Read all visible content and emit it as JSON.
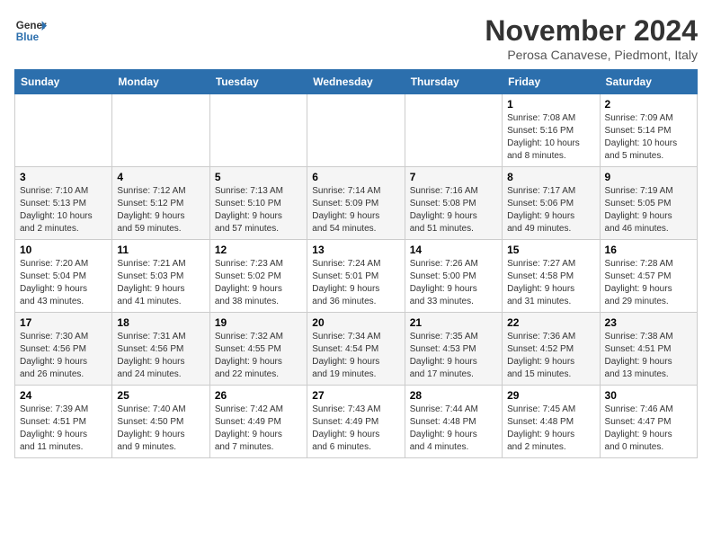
{
  "header": {
    "logo_line1": "General",
    "logo_line2": "Blue",
    "month_title": "November 2024",
    "location": "Perosa Canavese, Piedmont, Italy"
  },
  "weekdays": [
    "Sunday",
    "Monday",
    "Tuesday",
    "Wednesday",
    "Thursday",
    "Friday",
    "Saturday"
  ],
  "weeks": [
    [
      {
        "day": "",
        "info": ""
      },
      {
        "day": "",
        "info": ""
      },
      {
        "day": "",
        "info": ""
      },
      {
        "day": "",
        "info": ""
      },
      {
        "day": "",
        "info": ""
      },
      {
        "day": "1",
        "info": "Sunrise: 7:08 AM\nSunset: 5:16 PM\nDaylight: 10 hours\nand 8 minutes."
      },
      {
        "day": "2",
        "info": "Sunrise: 7:09 AM\nSunset: 5:14 PM\nDaylight: 10 hours\nand 5 minutes."
      }
    ],
    [
      {
        "day": "3",
        "info": "Sunrise: 7:10 AM\nSunset: 5:13 PM\nDaylight: 10 hours\nand 2 minutes."
      },
      {
        "day": "4",
        "info": "Sunrise: 7:12 AM\nSunset: 5:12 PM\nDaylight: 9 hours\nand 59 minutes."
      },
      {
        "day": "5",
        "info": "Sunrise: 7:13 AM\nSunset: 5:10 PM\nDaylight: 9 hours\nand 57 minutes."
      },
      {
        "day": "6",
        "info": "Sunrise: 7:14 AM\nSunset: 5:09 PM\nDaylight: 9 hours\nand 54 minutes."
      },
      {
        "day": "7",
        "info": "Sunrise: 7:16 AM\nSunset: 5:08 PM\nDaylight: 9 hours\nand 51 minutes."
      },
      {
        "day": "8",
        "info": "Sunrise: 7:17 AM\nSunset: 5:06 PM\nDaylight: 9 hours\nand 49 minutes."
      },
      {
        "day": "9",
        "info": "Sunrise: 7:19 AM\nSunset: 5:05 PM\nDaylight: 9 hours\nand 46 minutes."
      }
    ],
    [
      {
        "day": "10",
        "info": "Sunrise: 7:20 AM\nSunset: 5:04 PM\nDaylight: 9 hours\nand 43 minutes."
      },
      {
        "day": "11",
        "info": "Sunrise: 7:21 AM\nSunset: 5:03 PM\nDaylight: 9 hours\nand 41 minutes."
      },
      {
        "day": "12",
        "info": "Sunrise: 7:23 AM\nSunset: 5:02 PM\nDaylight: 9 hours\nand 38 minutes."
      },
      {
        "day": "13",
        "info": "Sunrise: 7:24 AM\nSunset: 5:01 PM\nDaylight: 9 hours\nand 36 minutes."
      },
      {
        "day": "14",
        "info": "Sunrise: 7:26 AM\nSunset: 5:00 PM\nDaylight: 9 hours\nand 33 minutes."
      },
      {
        "day": "15",
        "info": "Sunrise: 7:27 AM\nSunset: 4:58 PM\nDaylight: 9 hours\nand 31 minutes."
      },
      {
        "day": "16",
        "info": "Sunrise: 7:28 AM\nSunset: 4:57 PM\nDaylight: 9 hours\nand 29 minutes."
      }
    ],
    [
      {
        "day": "17",
        "info": "Sunrise: 7:30 AM\nSunset: 4:56 PM\nDaylight: 9 hours\nand 26 minutes."
      },
      {
        "day": "18",
        "info": "Sunrise: 7:31 AM\nSunset: 4:56 PM\nDaylight: 9 hours\nand 24 minutes."
      },
      {
        "day": "19",
        "info": "Sunrise: 7:32 AM\nSunset: 4:55 PM\nDaylight: 9 hours\nand 22 minutes."
      },
      {
        "day": "20",
        "info": "Sunrise: 7:34 AM\nSunset: 4:54 PM\nDaylight: 9 hours\nand 19 minutes."
      },
      {
        "day": "21",
        "info": "Sunrise: 7:35 AM\nSunset: 4:53 PM\nDaylight: 9 hours\nand 17 minutes."
      },
      {
        "day": "22",
        "info": "Sunrise: 7:36 AM\nSunset: 4:52 PM\nDaylight: 9 hours\nand 15 minutes."
      },
      {
        "day": "23",
        "info": "Sunrise: 7:38 AM\nSunset: 4:51 PM\nDaylight: 9 hours\nand 13 minutes."
      }
    ],
    [
      {
        "day": "24",
        "info": "Sunrise: 7:39 AM\nSunset: 4:51 PM\nDaylight: 9 hours\nand 11 minutes."
      },
      {
        "day": "25",
        "info": "Sunrise: 7:40 AM\nSunset: 4:50 PM\nDaylight: 9 hours\nand 9 minutes."
      },
      {
        "day": "26",
        "info": "Sunrise: 7:42 AM\nSunset: 4:49 PM\nDaylight: 9 hours\nand 7 minutes."
      },
      {
        "day": "27",
        "info": "Sunrise: 7:43 AM\nSunset: 4:49 PM\nDaylight: 9 hours\nand 6 minutes."
      },
      {
        "day": "28",
        "info": "Sunrise: 7:44 AM\nSunset: 4:48 PM\nDaylight: 9 hours\nand 4 minutes."
      },
      {
        "day": "29",
        "info": "Sunrise: 7:45 AM\nSunset: 4:48 PM\nDaylight: 9 hours\nand 2 minutes."
      },
      {
        "day": "30",
        "info": "Sunrise: 7:46 AM\nSunset: 4:47 PM\nDaylight: 9 hours\nand 0 minutes."
      }
    ]
  ]
}
